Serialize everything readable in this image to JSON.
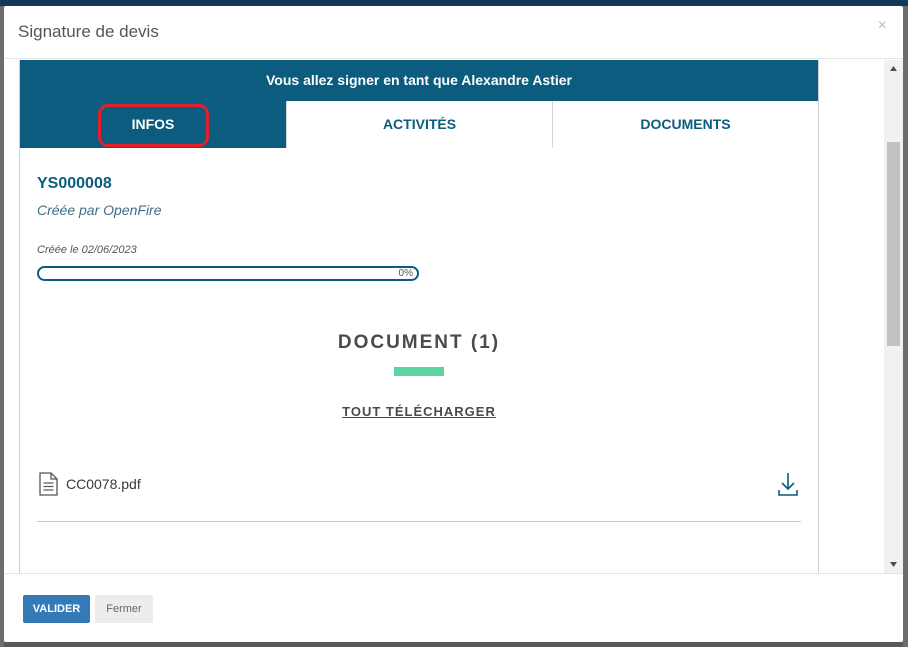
{
  "modal": {
    "title": "Signature de devis",
    "close_label": "×"
  },
  "signing": {
    "banner": "Vous allez signer en tant que Alexandre Astier"
  },
  "tabs": [
    {
      "label": "INFOS",
      "active": true
    },
    {
      "label": "ACTIVITÉS",
      "active": false
    },
    {
      "label": "DOCUMENTS",
      "active": false
    }
  ],
  "quote": {
    "reference": "YS000008",
    "created_by": "Créée par OpenFire",
    "created_date": "Créée le 02/06/2023",
    "progress_percent": 0,
    "progress_label": "0%"
  },
  "documents": {
    "heading": "DOCUMENT (1)",
    "download_all": "TOUT TÉLÉCHARGER",
    "files": [
      {
        "name": "CC0078.pdf",
        "icon": "file-text-icon",
        "action_icon": "download-icon"
      }
    ]
  },
  "footer": {
    "validate_label": "VALIDER",
    "close_label": "Fermer"
  },
  "colors": {
    "primary": "#0b5c7e",
    "accent": "#5dd3a2",
    "button_primary": "#337ab7",
    "highlight": "#e0202a"
  }
}
